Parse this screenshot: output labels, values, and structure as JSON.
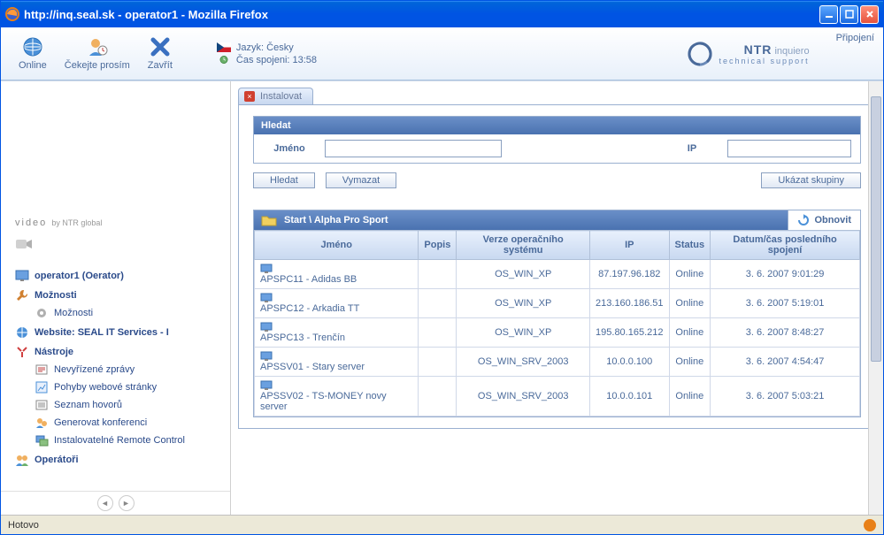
{
  "window": {
    "title": "http://inq.seal.sk - operator1 - Mozilla Firefox"
  },
  "toolbar": {
    "online": "Online",
    "wait": "Čekejte prosím",
    "close": "Zavřít",
    "lang_label": "Jazyk:",
    "lang_value": "Česky",
    "time_label": "Čas spojeni:",
    "time_value": "13:58",
    "logo": "NTR",
    "logo_sub1": "inquiero",
    "logo_sub2": "technical support",
    "connection": "Připojení"
  },
  "sidebar": {
    "video": "video",
    "video_by": "by NTR global",
    "operator": "operator1 (Oerator)",
    "options": "Možnosti",
    "options_sub": "Možnosti",
    "website": "Website: SEAL IT Services - I",
    "tools": "Nástroje",
    "tool_items": [
      "Nevyřízené zprávy",
      "Pohyby webové stránky",
      "Seznam hovorů",
      "Generovat konferenci",
      "Instalovatelné Remote Control"
    ],
    "operators": "Operátoři"
  },
  "tab": {
    "label": "Instalovat"
  },
  "search": {
    "title": "Hledat",
    "name_label": "Jméno",
    "name_value": "",
    "ip_label": "IP",
    "ip_value": "",
    "btn_search": "Hledat",
    "btn_clear": "Vymazat",
    "btn_groups": "Ukázat skupiny"
  },
  "grid": {
    "path": "Start \\ Alpha Pro Sport",
    "refresh": "Obnovit",
    "cols": {
      "name": "Jméno",
      "desc": "Popis",
      "os": "Verze operačního systému",
      "ip": "IP",
      "status": "Status",
      "last": "Datum/čas posledního spojení"
    },
    "rows": [
      {
        "name": "APSPC11 - Adidas BB",
        "desc": "",
        "os": "OS_WIN_XP",
        "ip": "87.197.96.182",
        "status": "Online",
        "last": "3. 6. 2007 9:01:29"
      },
      {
        "name": "APSPC12 - Arkadia TT",
        "desc": "",
        "os": "OS_WIN_XP",
        "ip": "213.160.186.51",
        "status": "Online",
        "last": "3. 6. 2007 5:19:01"
      },
      {
        "name": "APSPC13 - Trenčín",
        "desc": "",
        "os": "OS_WIN_XP",
        "ip": "195.80.165.212",
        "status": "Online",
        "last": "3. 6. 2007 8:48:27"
      },
      {
        "name": "APSSV01 - Stary server",
        "desc": "",
        "os": "OS_WIN_SRV_2003",
        "ip": "10.0.0.100",
        "status": "Online",
        "last": "3. 6. 2007 4:54:47"
      },
      {
        "name": "APSSV02 - TS-MONEY novy server",
        "desc": "",
        "os": "OS_WIN_SRV_2003",
        "ip": "10.0.0.101",
        "status": "Online",
        "last": "3. 6. 2007 5:03:21"
      }
    ]
  },
  "status": {
    "text": "Hotovo"
  }
}
